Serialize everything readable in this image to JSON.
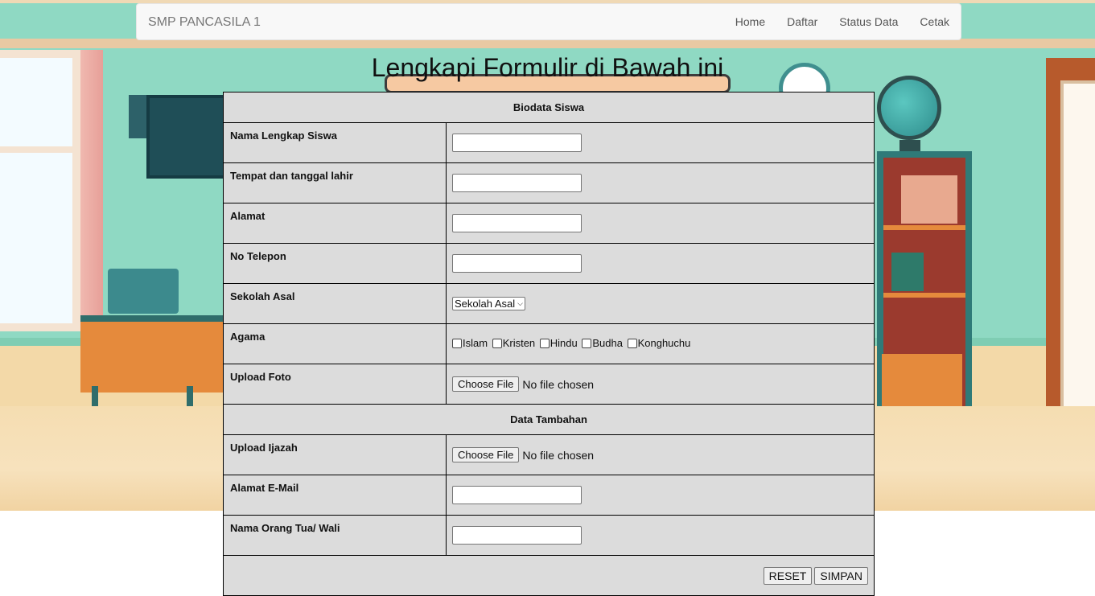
{
  "navbar": {
    "brand": "SMP PANCASILA 1",
    "links": [
      "Home",
      "Daftar",
      "Status Data",
      "Cetak"
    ]
  },
  "page_title": "Lengkapi Formulir di Bawah ini",
  "sections": {
    "biodata": "Biodata Siswa",
    "tambahan": "Data Tambahan"
  },
  "fields": {
    "nama": {
      "label": "Nama Lengkap Siswa",
      "value": ""
    },
    "ttl": {
      "label": "Tempat dan tanggal lahir",
      "value": ""
    },
    "alamat": {
      "label": "Alamat",
      "value": ""
    },
    "telepon": {
      "label": "No Telepon",
      "value": ""
    },
    "sekolah": {
      "label": "Sekolah Asal",
      "selected": "Sekolah Asal"
    },
    "agama": {
      "label": "Agama",
      "options": [
        "Islam",
        "Kristen",
        "Hindu",
        "Budha",
        "Konghuchu"
      ]
    },
    "foto": {
      "label": "Upload Foto",
      "button": "Choose File",
      "status": "No file chosen"
    },
    "ijazah": {
      "label": "Upload Ijazah",
      "button": "Choose File",
      "status": "No file chosen"
    },
    "email": {
      "label": "Alamat E-Mail",
      "value": ""
    },
    "wali": {
      "label": "Nama Orang Tua/ Wali",
      "value": ""
    }
  },
  "buttons": {
    "reset": "RESET",
    "simpan": "SIMPAN"
  },
  "colors": {
    "table_bg": "#dcdcdc",
    "navbar_bg": "#f8f8f8",
    "wall": "#8fd9c3"
  },
  "background": {
    "scene": "classroom-illustration"
  }
}
